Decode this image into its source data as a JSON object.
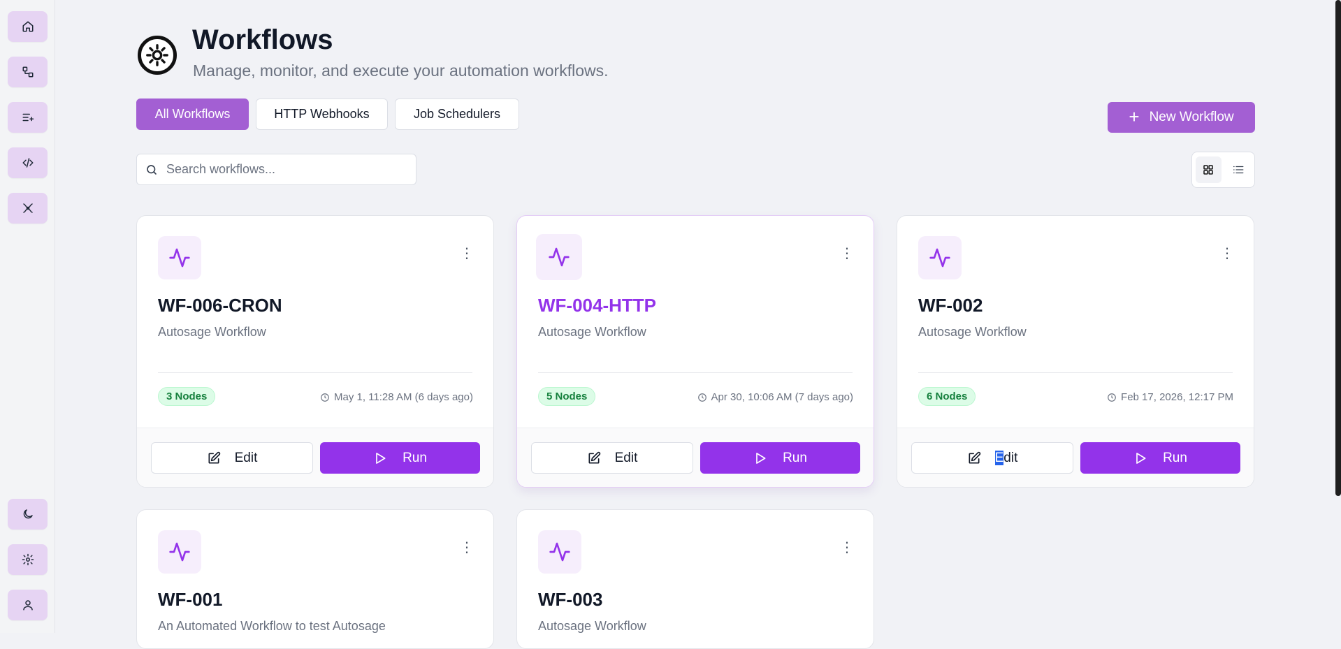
{
  "header": {
    "title": "Workflows",
    "subtitle": "Manage, monitor, and execute your automation workflows."
  },
  "tabs": [
    {
      "label": "All Workflows",
      "active": true
    },
    {
      "label": "HTTP Webhooks",
      "active": false
    },
    {
      "label": "Job Schedulers",
      "active": false
    }
  ],
  "new_button": {
    "label": "New Workflow",
    "icon": "plus-icon"
  },
  "search": {
    "placeholder": "Search workflows...",
    "value": ""
  },
  "view_toggle": {
    "active": "grid",
    "options": [
      "grid-view-icon",
      "list-view-icon"
    ]
  },
  "sidebar": {
    "top_items": [
      "home-icon",
      "workflow-icon",
      "list-add-icon",
      "code-icon",
      "integrations-icon"
    ],
    "bottom_items": [
      "moon-icon",
      "gear-icon",
      "user-icon"
    ]
  },
  "colors": {
    "accent": "#a35fd3",
    "primary": "#9333ea",
    "badge_bg": "#dcfce7",
    "badge_text": "#15803d"
  },
  "cards": [
    {
      "title": "WF-006-CRON",
      "description": "Autosage Workflow",
      "nodes": "3 Nodes",
      "date": "May 1, 11:28 AM (6 days ago)",
      "edit_label": "Edit",
      "run_label": "Run"
    },
    {
      "title": "WF-004-HTTP",
      "description": "Autosage Workflow",
      "nodes": "5 Nodes",
      "date": "Apr 30, 10:06 AM (7 days ago)",
      "edit_label": "Edit",
      "run_label": "Run"
    },
    {
      "title": "WF-002",
      "description": "Autosage Workflow",
      "nodes": "6 Nodes",
      "date": "Feb 17, 2026, 12:17 PM",
      "edit_label": "Edit",
      "edit_label_first": "E",
      "edit_label_rest": "dit",
      "run_label": "Run"
    },
    {
      "title": "WF-001",
      "description": "An Automated Workflow to test Autosage"
    },
    {
      "title": "WF-003",
      "description": "Autosage Workflow"
    }
  ]
}
